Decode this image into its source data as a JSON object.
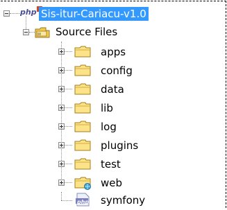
{
  "tree": {
    "root": {
      "label": "Sis-itur-Cariacu-v1.0",
      "badge": "php"
    },
    "source_files": {
      "label": "Source Files"
    },
    "folders": [
      {
        "label": "apps"
      },
      {
        "label": "config"
      },
      {
        "label": "data"
      },
      {
        "label": "lib"
      },
      {
        "label": "log"
      },
      {
        "label": "plugins"
      },
      {
        "label": "test"
      },
      {
        "label": "web"
      }
    ],
    "file": {
      "label": "symfony",
      "badge": "php"
    }
  }
}
